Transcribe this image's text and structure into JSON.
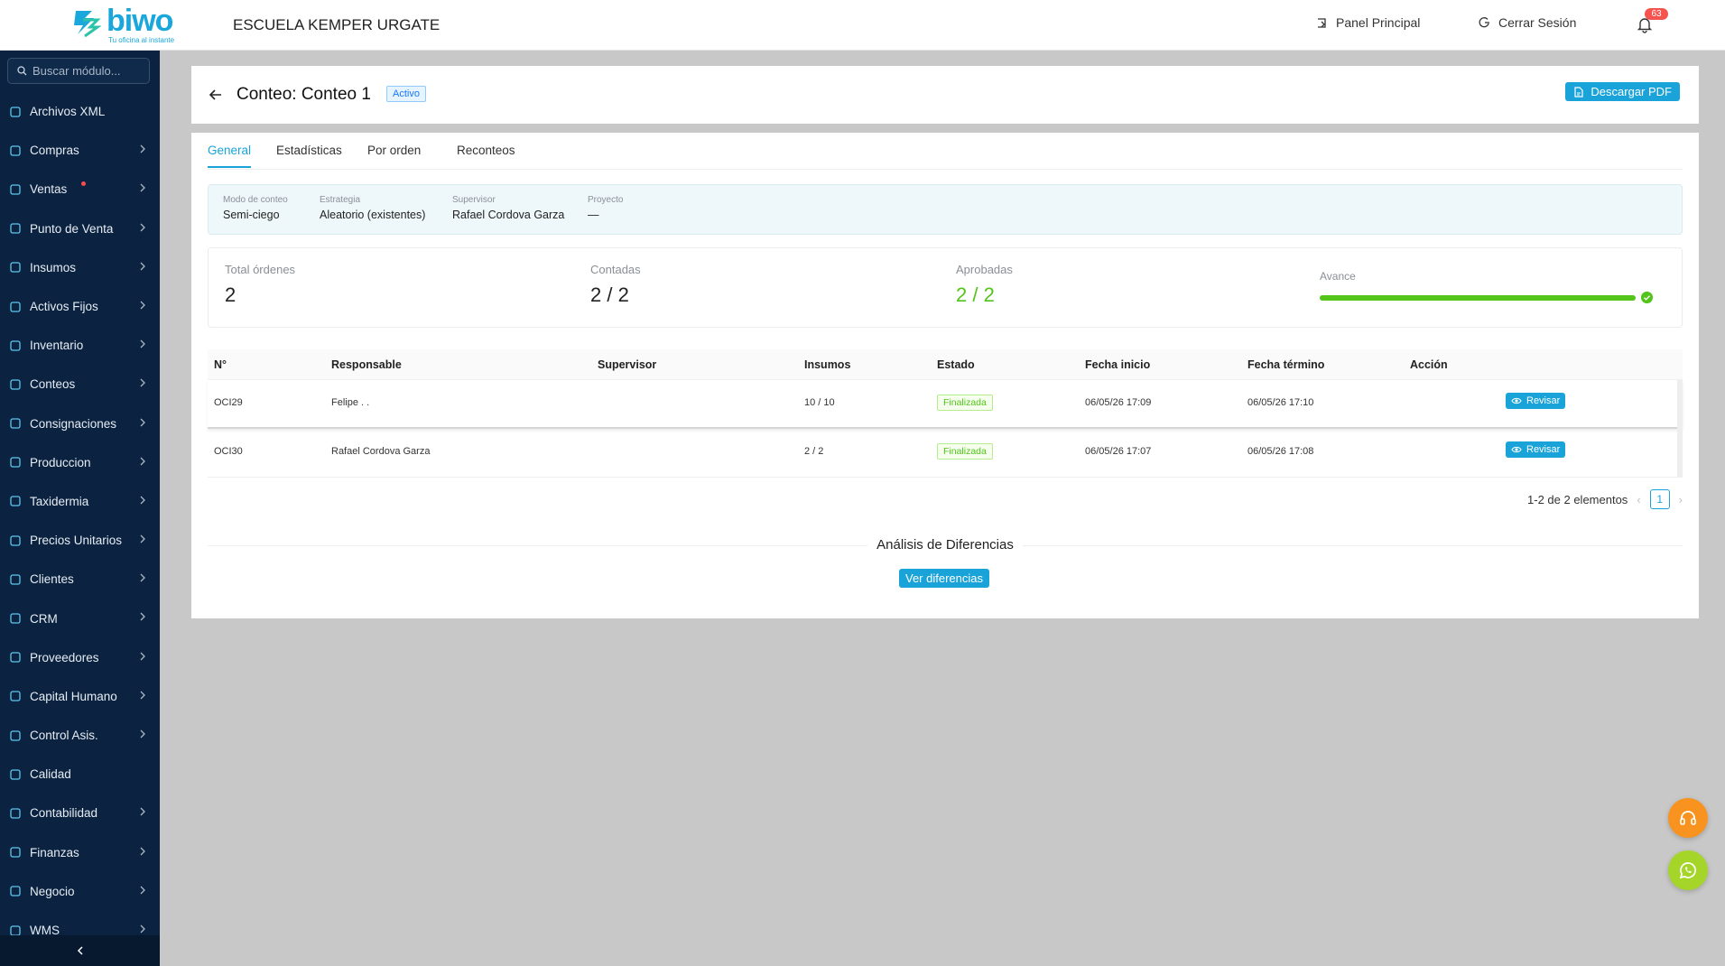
{
  "header": {
    "logo_text": "biwo",
    "logo_tagline": "Tu oficina al instante",
    "company_name": "ESCUELA KEMPER URGATE",
    "panel_link": "Panel Principal",
    "logout_link": "Cerrar Sesión",
    "notification_count": "63"
  },
  "sidebar": {
    "search_placeholder": "Buscar módulo...",
    "items": [
      {
        "label": "Archivos XML",
        "icon": "xml-icon",
        "chevron": false
      },
      {
        "label": "Compras",
        "icon": "cart-icon",
        "chevron": true
      },
      {
        "label": "Ventas",
        "icon": "tag-icon",
        "chevron": true,
        "dot": true
      },
      {
        "label": "Punto de Venta",
        "icon": "pos-icon",
        "chevron": true
      },
      {
        "label": "Insumos",
        "icon": "supplies-icon",
        "chevron": true
      },
      {
        "label": "Activos Fijos",
        "icon": "assets-icon",
        "chevron": true
      },
      {
        "label": "Inventario",
        "icon": "inventory-icon",
        "chevron": true
      },
      {
        "label": "Conteos",
        "icon": "counts-icon",
        "chevron": true
      },
      {
        "label": "Consignaciones",
        "icon": "consign-icon",
        "chevron": true
      },
      {
        "label": "Produccion",
        "icon": "wrench-icon",
        "chevron": true
      },
      {
        "label": "Taxidermia",
        "icon": "taxidermy-icon",
        "chevron": true
      },
      {
        "label": "Precios Unitarios",
        "icon": "prices-icon",
        "chevron": true
      },
      {
        "label": "Clientes",
        "icon": "clients-icon",
        "chevron": true
      },
      {
        "label": "CRM",
        "icon": "crm-icon",
        "chevron": true
      },
      {
        "label": "Proveedores",
        "icon": "suppliers-icon",
        "chevron": true
      },
      {
        "label": "Capital Humano",
        "icon": "people-icon",
        "chevron": true
      },
      {
        "label": "Control Asis.",
        "icon": "calendar-icon",
        "chevron": true
      },
      {
        "label": "Calidad",
        "icon": "quality-icon",
        "chevron": false
      },
      {
        "label": "Contabilidad",
        "icon": "bank-icon",
        "chevron": true
      },
      {
        "label": "Finanzas",
        "icon": "finance-icon",
        "chevron": true
      },
      {
        "label": "Negocio",
        "icon": "business-icon",
        "chevron": true
      },
      {
        "label": "WMS",
        "icon": "location-icon",
        "chevron": true
      }
    ]
  },
  "page": {
    "title": "Conteo: Conteo 1",
    "status": "Activo",
    "pdf_button": "Descargar PDF"
  },
  "tabs": [
    "General",
    "Estadísticas",
    "Por orden",
    "Reconteos"
  ],
  "info": [
    {
      "label": "Modo de conteo",
      "value": "Semi-ciego"
    },
    {
      "label": "Estrategia",
      "value": "Aleatorio (existentes)"
    },
    {
      "label": "Supervisor",
      "value": "Rafael Cordova Garza"
    },
    {
      "label": "Proyecto",
      "value": "—"
    }
  ],
  "stats": {
    "total_label": "Total órdenes",
    "total_value": "2",
    "counted_label": "Contadas",
    "counted_value": "2 / 2",
    "approved_label": "Aprobadas",
    "approved_value": "2 / 2",
    "progress_label": "Avance",
    "progress_percent": 100
  },
  "table": {
    "headers": [
      "N°",
      "Responsable",
      "Supervisor",
      "Insumos",
      "Estado",
      "Fecha inicio",
      "Fecha término",
      "Acción"
    ],
    "rows": [
      {
        "num": "OCI29",
        "responsable": "Felipe . .",
        "supervisor": "",
        "insumos": "10 / 10",
        "estado": "Finalizada",
        "inicio": "06/05/26 17:09",
        "termino": "06/05/26 17:10",
        "accion": "Revisar"
      },
      {
        "num": "OCI30",
        "responsable": "Rafael Cordova Garza",
        "supervisor": "",
        "insumos": "2 / 2",
        "estado": "Finalizada",
        "inicio": "06/05/26 17:07",
        "termino": "06/05/26 17:08",
        "accion": "Revisar"
      }
    ]
  },
  "pagination": {
    "summary": "1-2 de 2 elementos",
    "current": "1"
  },
  "differences": {
    "title": "Análisis de Diferencias",
    "button": "Ver diferencias"
  },
  "colors": {
    "accent": "#1aa3d9",
    "sidebar": "#0b2340",
    "success": "#52c41a",
    "support_fab": "#f7931e",
    "whatsapp_fab": "#a6d52a"
  }
}
